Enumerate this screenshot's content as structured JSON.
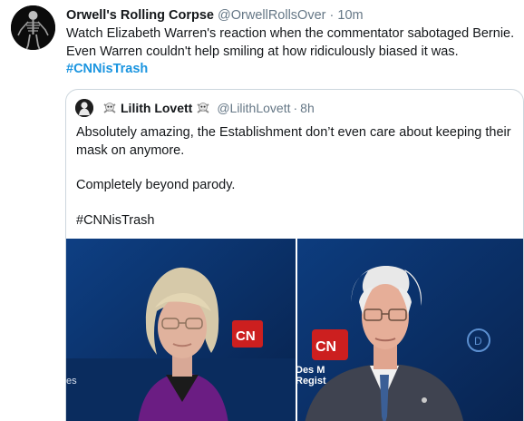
{
  "tweet": {
    "display_name": "Orwell's Rolling Corpse",
    "handle": "@OrwellRollsOver",
    "separator": "·",
    "time": "10m",
    "text": "Watch Elizabeth Warren's reaction when the commentator sabotaged Bernie. Even Warren couldn't help smiling at how ridiculously biased it was. ",
    "hashtag": "#CNNisTrash",
    "avatar_icon": "skeleton-avatar"
  },
  "quote": {
    "display_name": "Lilith Lovett",
    "handle": "@LilithLovett",
    "separator": "·",
    "time": "8h",
    "emoji_icon": "skull-crossbones-icon",
    "paragraphs": [
      "Absolutely amazing, the Establishment don’t even care about keeping their mask on anymore.",
      "Completely beyond parody.",
      "#CNNisTrash"
    ],
    "media_left_caption": "es",
    "media_right_caption": "Des M\nRegist"
  },
  "colors": {
    "text": "#14171a",
    "muted": "#657786",
    "link": "#1b95e0",
    "border": "#ccd6dd",
    "cnn_red": "#cc1f1f"
  }
}
